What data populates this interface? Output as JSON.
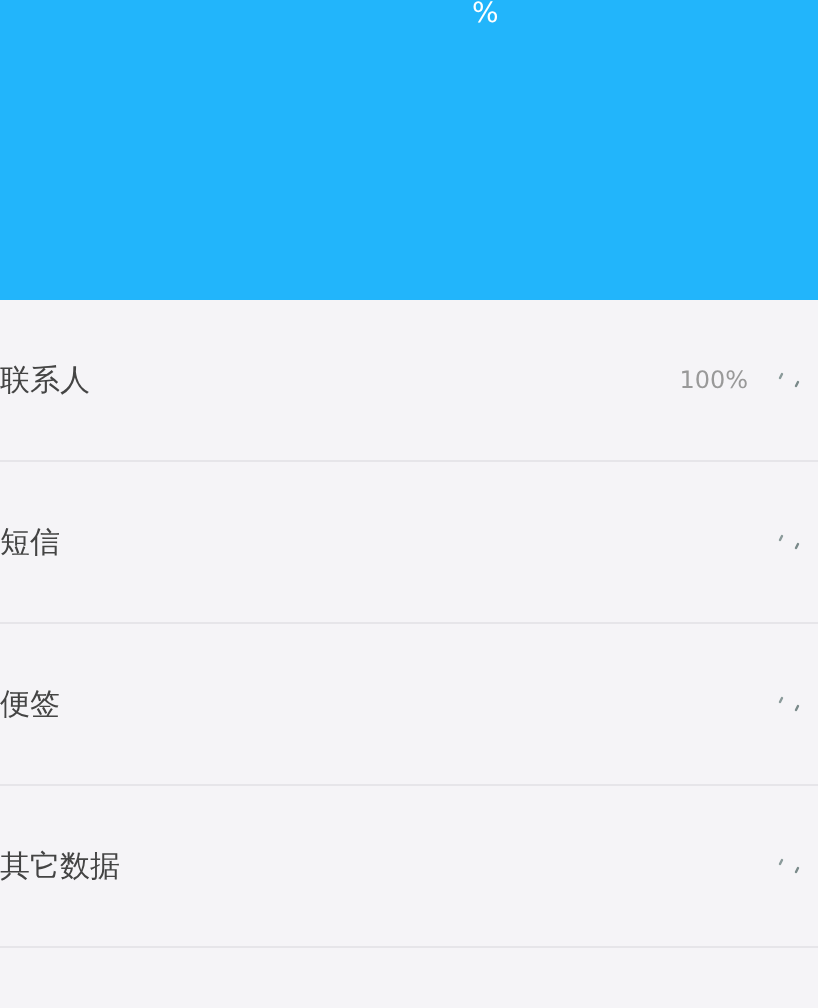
{
  "header": {
    "percent_sign": "%"
  },
  "items": [
    {
      "label": "联系人",
      "reading": "100%",
      "loading": true
    },
    {
      "label": "短信",
      "loading": true
    },
    {
      "label": "便签",
      "loading": true
    },
    {
      "label": "其它数据",
      "loading": true
    }
  ]
}
